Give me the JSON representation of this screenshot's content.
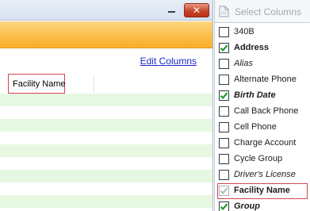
{
  "window": {
    "close_glyph": "✕"
  },
  "grid": {
    "edit_columns_label": "Edit Columns",
    "column_header": "Facility Name",
    "row_stripe_color": "#e6f8e1"
  },
  "panel": {
    "title": "Select Columns",
    "items": [
      {
        "label": "340B",
        "checked": false,
        "style": "normal"
      },
      {
        "label": "Address",
        "checked": true,
        "style": "bold"
      },
      {
        "label": "Alias",
        "checked": false,
        "style": "italic"
      },
      {
        "label": "Alternate Phone",
        "checked": false,
        "style": "normal"
      },
      {
        "label": "Birth Date",
        "checked": true,
        "style": "bold-italic"
      },
      {
        "label": "Call Back Phone",
        "checked": false,
        "style": "normal"
      },
      {
        "label": "Cell Phone",
        "checked": false,
        "style": "normal"
      },
      {
        "label": "Charge Account",
        "checked": false,
        "style": "normal"
      },
      {
        "label": "Cycle Group",
        "checked": false,
        "style": "normal"
      },
      {
        "label": "Driver's License",
        "checked": false,
        "style": "italic"
      },
      {
        "label": "Facility Name",
        "checked": true,
        "style": "bold",
        "disabled": true,
        "focused": true
      },
      {
        "label": "Group",
        "checked": true,
        "style": "bold-italic"
      }
    ]
  },
  "colors": {
    "ribbon": "#f7ad2a",
    "link": "#1a2cc8",
    "check": "#1e9a2e",
    "focus_outline": "#d64550"
  }
}
